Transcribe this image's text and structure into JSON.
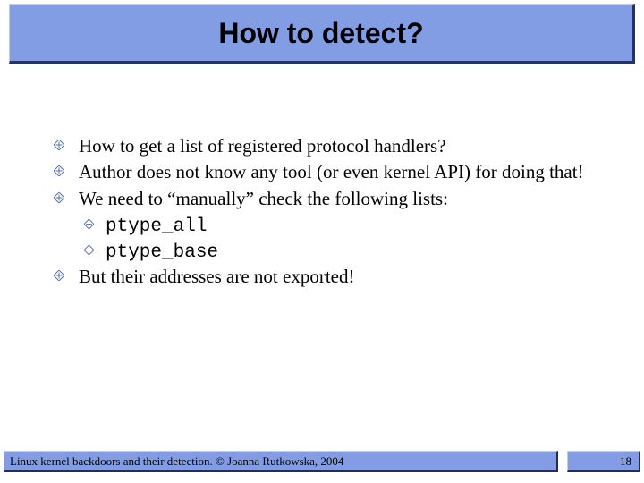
{
  "title": "How to detect?",
  "bullets": [
    {
      "text": "How to get a list of registered protocol handlers?"
    },
    {
      "text": "Author does not know any tool (or even kernel API) for doing that!"
    },
    {
      "text": "We need to “manually” check the following lists:",
      "sub": [
        {
          "code": "ptype_all"
        },
        {
          "code": "ptype_base"
        }
      ]
    },
    {
      "text": "But their addresses are not exported!"
    }
  ],
  "footer": {
    "left": "Linux kernel backdoors and their detection. © Joanna Rutkowska, 2004",
    "page": "18"
  }
}
